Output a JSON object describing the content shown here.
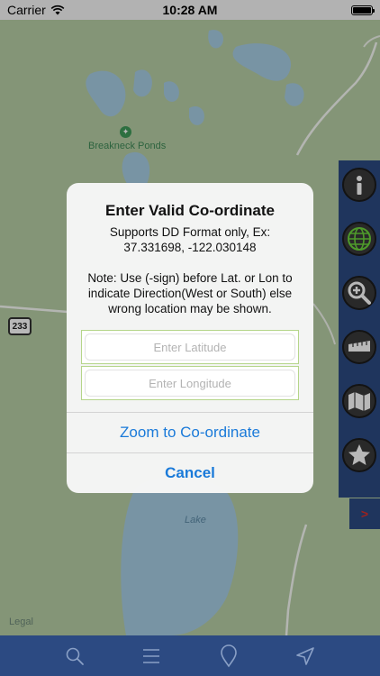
{
  "status": {
    "carrier": "Carrier",
    "time": "10:28 AM"
  },
  "map": {
    "poi_label": "Breakneck Ponds",
    "lake_label": "Lake",
    "legal": "Legal",
    "highway": "233"
  },
  "dialog": {
    "title": "Enter Valid Co-ordinate",
    "line1": "Supports DD Format only, Ex:",
    "line2": "37.331698, -122.030148",
    "note1": "Note: Use (-sign) before Lat. or Lon to",
    "note2": "indicate Direction(West or South) else",
    "note3": "wrong location may be shown.",
    "latitude_placeholder": "Enter Latitude",
    "longitude_placeholder": "Enter Longitude",
    "zoom_label": "Zoom to Co-ordinate",
    "cancel_label": "Cancel"
  },
  "toolbar": {
    "buttons": [
      "info-icon",
      "globe-icon",
      "zoom-in-icon",
      "ruler-icon",
      "map-layers-icon",
      "favorite-star-icon"
    ],
    "expand_glyph": ">"
  },
  "tabbar": {
    "tabs": [
      "search-icon",
      "menu-icon",
      "location-pin-icon",
      "navigation-arrow-icon"
    ]
  },
  "colors": {
    "accent": "#1a7ad9",
    "toolbar": "#2c4a82",
    "map_land": "#b8cfa6",
    "map_water": "#a7cde4"
  }
}
